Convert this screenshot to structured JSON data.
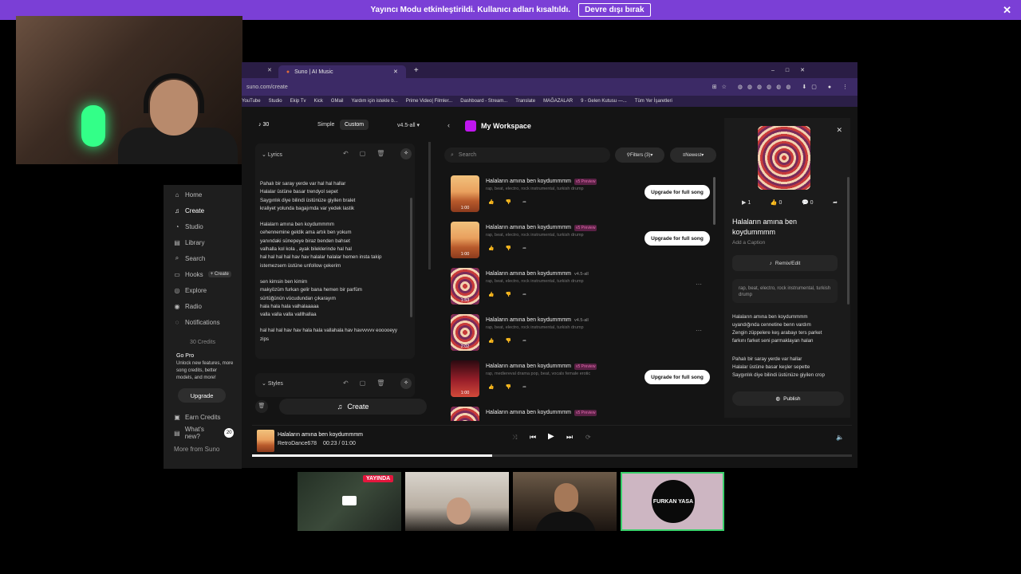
{
  "banner": {
    "message": "Yayıncı Modu etkinleştirildi. Kullanıcı adları kısaltıldı.",
    "button": "Devre dışı bırak"
  },
  "browser": {
    "tab_title": "Suno | AI Music",
    "url": "suno.com/create",
    "bookmarks": [
      "YouTube",
      "Studio",
      "Ekip Tv",
      "Kick",
      "GMail",
      "Yardım için isteklе b...",
      "Prime Video| Filmler...",
      "Dashboard - Stream...",
      "Translate",
      "MAĞAZALAR",
      "9 - Gelen Kutusu —...",
      "Tüm Yer İşaretleri"
    ]
  },
  "sidebar": {
    "items": [
      {
        "label": "Home",
        "icon": "home-icon"
      },
      {
        "label": "Create",
        "icon": "create-icon"
      },
      {
        "label": "Studio",
        "icon": "studio-icon"
      },
      {
        "label": "Library",
        "icon": "library-icon"
      },
      {
        "label": "Search",
        "icon": "search-icon"
      },
      {
        "label": "Hooks",
        "icon": "hooks-icon",
        "extra": "+ Create"
      },
      {
        "label": "Explore",
        "icon": "explore-icon"
      },
      {
        "label": "Radio",
        "icon": "radio-icon"
      },
      {
        "label": "Notifications",
        "icon": "bell-icon"
      }
    ],
    "credits": "30 Credits",
    "gopro_title": "Go Pro",
    "gopro_text": "Unlock new features, more song credits, better models, and more!",
    "upgrade": "Upgrade",
    "earn": "Earn Credits",
    "whats_new": "What's new?",
    "whats_new_count": "20",
    "more": "More from Suno"
  },
  "create": {
    "credits": "30",
    "mode_simple": "Simple",
    "mode_custom": "Custom",
    "version": "v4.5-all",
    "lyrics_label": "Lyrics",
    "styles_label": "Styles",
    "create_button": "Create",
    "lyrics": [
      "Pahalı bir saray yerde var  hal hal hallar\nHalalar üstüne basar trendyol sepet\nSaygınlık diye bilindi üstünüze giyilen bralet\nkraliyet yolunda bagajımda var yedek lastik",
      "Halalarn amına ben koydummmm\ncehennemine geldik ama artık ben yokum\nyanındaki sünepeye biraz benden bahset\nvalhalla kol kola , ayak bileklerinde hal hal\nhal hal hal hal hav hav halalar halalar hemen insta takip\nistemezsem üstüne unfollow çekerim",
      "sen kimsin ben kimim\nmakyözüm furkan gelir bana hemen bir parfüm\nsürtüğünün vücudundan çıkarayım\nhala hala hala valhalaaaaa\nvalla valla valla  valllhallaa",
      "hal hal hal hav hav hala hala vallahala hav havvvvvv  eooooeyy\nzips"
    ]
  },
  "workspace": {
    "title": "My Workspace",
    "search_placeholder": "Search",
    "filters": "Filters (3)",
    "sort": "Newest",
    "songs": [
      {
        "title": "Halaların amına ben koydummmm",
        "badge": "v5 Preview",
        "tags": "rap, beat, electro, rock instrumental, turkish drump",
        "duration": "1:00",
        "action": "Upgrade for full song",
        "thumb": "desert"
      },
      {
        "title": "Halaların amına ben koydummmm",
        "badge": "v5 Preview",
        "tags": "rap, beat, electro, rock instrumental, turkish drump",
        "duration": "1:00",
        "action": "Upgrade for full song",
        "thumb": "desert"
      },
      {
        "title": "Halaların amına ben koydummmm",
        "ver": "v4.5-all",
        "tags": "rap, beat, electro, rock instrumental, turkish drump",
        "duration": "1:53",
        "action": "",
        "thumb": "spiral"
      },
      {
        "title": "Halaların amına ben koydummmm",
        "ver": "v4.5-all",
        "tags": "rap, beat, electro, rock instrumental, turkish drump",
        "duration": "2:02",
        "action": "",
        "thumb": "spiral"
      },
      {
        "title": "Halaların amına ben koydummmm",
        "badge": "v5 Preview",
        "tags": "rap, mediereval drama pop, beat, vocals female erotic",
        "duration": "1:00",
        "action": "Upgrade for full song",
        "thumb": "redhall"
      },
      {
        "title": "Halaların amına ben koydummmm",
        "badge": "v5 Preview",
        "tags": "",
        "duration": "",
        "action": "",
        "thumb": "spiral"
      }
    ]
  },
  "detail": {
    "plays": "1",
    "likes": "0",
    "comments": "0",
    "title": "Halaların amına ben koydummmm",
    "caption": "Add a Caption",
    "remix": "Remix/Edit",
    "tags": "rap, beat, electro, rock instrumental, turkish drump",
    "lyrics": "Halaların amına ben koydummmm\nuyandığında cennetine benn vardım\nZengin züppelere keş arabayı ters parket\nfarkını farket seni parmaklayan halan",
    "lyrics2": "Pahalı bir saray yerde var hallar\nHalalar üstüne basar keşler sepette\nSaygınlık diye bilindi üstünüze giyilen crop",
    "publish": "Publish"
  },
  "player": {
    "title": "Halaların amına ben koydummmm",
    "artist": "RetroDance678",
    "time": "00:23 / 01:00",
    "progress": 0.4
  },
  "guests": {
    "live_badge": "YAYINDA",
    "avatar_text": "FURKAN YASA"
  }
}
